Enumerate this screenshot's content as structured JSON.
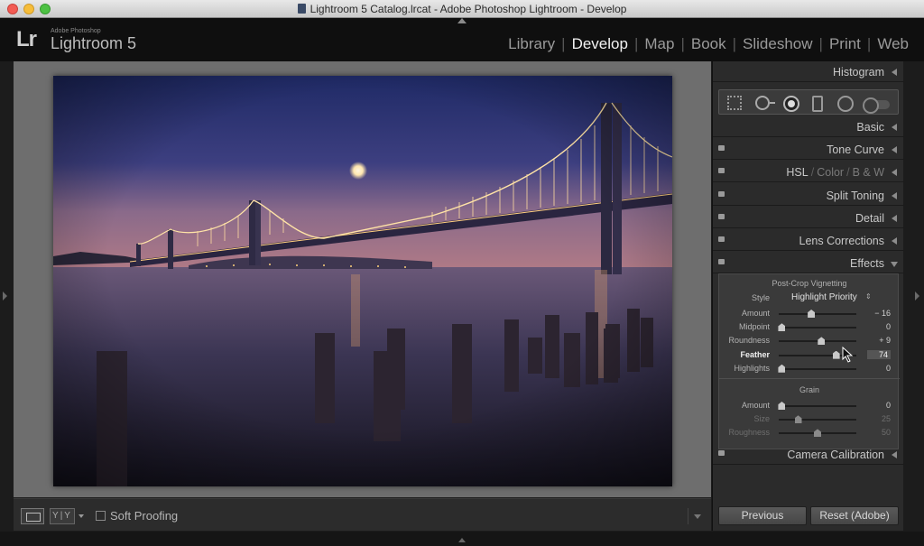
{
  "window": {
    "title": "Lightroom 5 Catalog.lrcat - Adobe Photoshop Lightroom - Develop"
  },
  "brand": {
    "logo": "Lr",
    "small": "Adobe Photoshop",
    "name": "Lightroom 5"
  },
  "modules": [
    "Library",
    "Develop",
    "Map",
    "Book",
    "Slideshow",
    "Print",
    "Web"
  ],
  "active_module": "Develop",
  "panel": {
    "histogram": "Histogram",
    "basic": "Basic",
    "tone_curve": "Tone Curve",
    "hsl": {
      "h": "HSL",
      "c": "Color",
      "bw": "B & W"
    },
    "split_toning": "Split Toning",
    "detail": "Detail",
    "lens_corrections": "Lens Corrections",
    "effects": "Effects",
    "camera_calibration": "Camera Calibration"
  },
  "effects": {
    "vignette_title": "Post-Crop Vignetting",
    "style_label": "Style",
    "style_value": "Highlight Priority",
    "style_arrows": "⇕",
    "sliders": [
      {
        "label": "Amount",
        "value": "− 16",
        "pos": 0.42
      },
      {
        "label": "Midpoint",
        "value": "0",
        "pos": 0.04
      },
      {
        "label": "Roundness",
        "value": "+ 9",
        "pos": 0.55
      },
      {
        "label": "Feather",
        "value": "74",
        "pos": 0.74
      },
      {
        "label": "Highlights",
        "value": "0",
        "pos": 0.04
      }
    ],
    "grain_title": "Grain",
    "grain_sliders": [
      {
        "label": "Amount",
        "value": "0",
        "pos": 0.04
      },
      {
        "label": "Size",
        "value": "25",
        "pos": 0.25
      },
      {
        "label": "Roughness",
        "value": "50",
        "pos": 0.5
      }
    ]
  },
  "toolbar": {
    "yy": "Y|Y",
    "soft_proofing": "Soft Proofing"
  },
  "buttons": {
    "previous": "Previous",
    "reset": "Reset (Adobe)"
  }
}
